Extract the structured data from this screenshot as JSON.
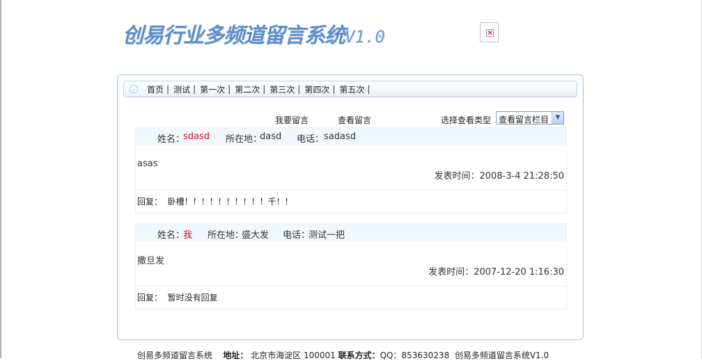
{
  "header": {
    "logo_text": "创易行业多频道留言系统",
    "logo_version": "V1.0",
    "broken_image_glyph": "✕"
  },
  "nav": {
    "items": [
      "首页",
      "测试",
      "第一次",
      "第二次",
      "第三次",
      "第四次",
      "第五次"
    ],
    "separator": "|"
  },
  "toolbar": {
    "post_message": "我要留言",
    "view_messages": "查看留言",
    "type_label": "选择查看类型",
    "select_value": "查看留言栏目"
  },
  "messages": [
    {
      "name_label": "姓名：",
      "name": "sdasd",
      "location_label": "所在地：",
      "location": "dasd",
      "phone_label": "电话：",
      "phone": "sadasd",
      "content": "asas",
      "time_label": "发表时间：",
      "time": "2008-3-4 21:28:50",
      "reply_label": "回复：",
      "reply": "卧槽！！！！！！！！！！千！！"
    },
    {
      "name_label": "姓名：",
      "name": "我",
      "location_label": "所在地：",
      "location": "盛大发",
      "phone_label": "电话：",
      "phone": "测试一把",
      "content": "撒旦发",
      "time_label": "发表时间：",
      "time": "2007-12-20 1:16:30",
      "reply_label": "回复：",
      "reply": "暂时没有回复"
    }
  ],
  "footer": {
    "site_name": "创易多频道留言系统",
    "address_label": "地址：",
    "address": "北京市海淀区 100001",
    "contact_label": "联系方式：",
    "contact": "QQ：853630238",
    "site_name_version": "创易多频道留言系统V1.0"
  },
  "colors": {
    "logo": "#5c8ec9",
    "accent_name": "#c4142b",
    "frame_border": "#9fc9d6",
    "row_header_bg": "#f2f7fb"
  }
}
